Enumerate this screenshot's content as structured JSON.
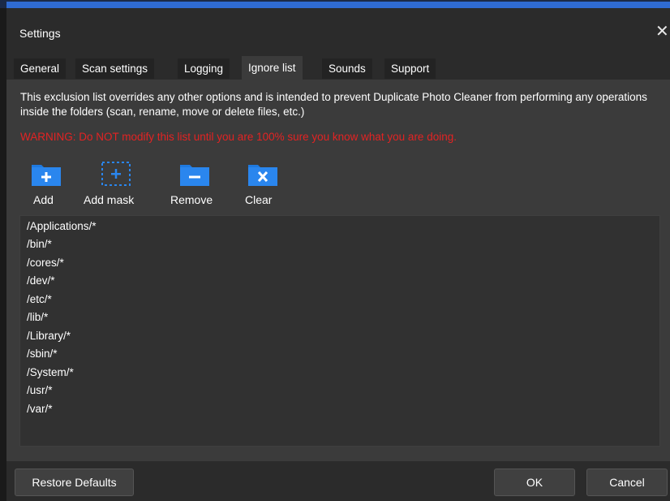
{
  "window": {
    "title": "Settings"
  },
  "tabs": [
    "General",
    "Scan settings",
    "Logging",
    "Ignore list",
    "Sounds",
    "Support"
  ],
  "active_tab": "Ignore list",
  "description": "This exclusion list overrides any other options and is intended to prevent Duplicate Photo Cleaner from performing any operations inside the folders (scan, rename, move or delete files, etc.)",
  "warning": "WARNING: Do NOT modify this list until you are 100% sure you know what you are doing.",
  "toolbar": {
    "add": "Add",
    "add_mask": "Add mask",
    "remove": "Remove",
    "clear": "Clear"
  },
  "ignore_list": [
    "/Applications/*",
    "/bin/*",
    "/cores/*",
    "/dev/*",
    "/etc/*",
    "/lib/*",
    "/Library/*",
    "/sbin/*",
    "/System/*",
    "/usr/*",
    "/var/*"
  ],
  "buttons": {
    "restore_defaults": "Restore Defaults",
    "ok": "OK",
    "cancel": "Cancel"
  },
  "colors": {
    "accent_blue": "#1f7ae0",
    "warning_red": "#e32323",
    "pane_bg": "#3b3b3b"
  },
  "icons": {
    "add": "folder-plus-icon",
    "add_mask": "folder-mask-icon",
    "remove": "folder-minus-icon",
    "clear": "folder-x-icon",
    "close": "close-icon"
  }
}
